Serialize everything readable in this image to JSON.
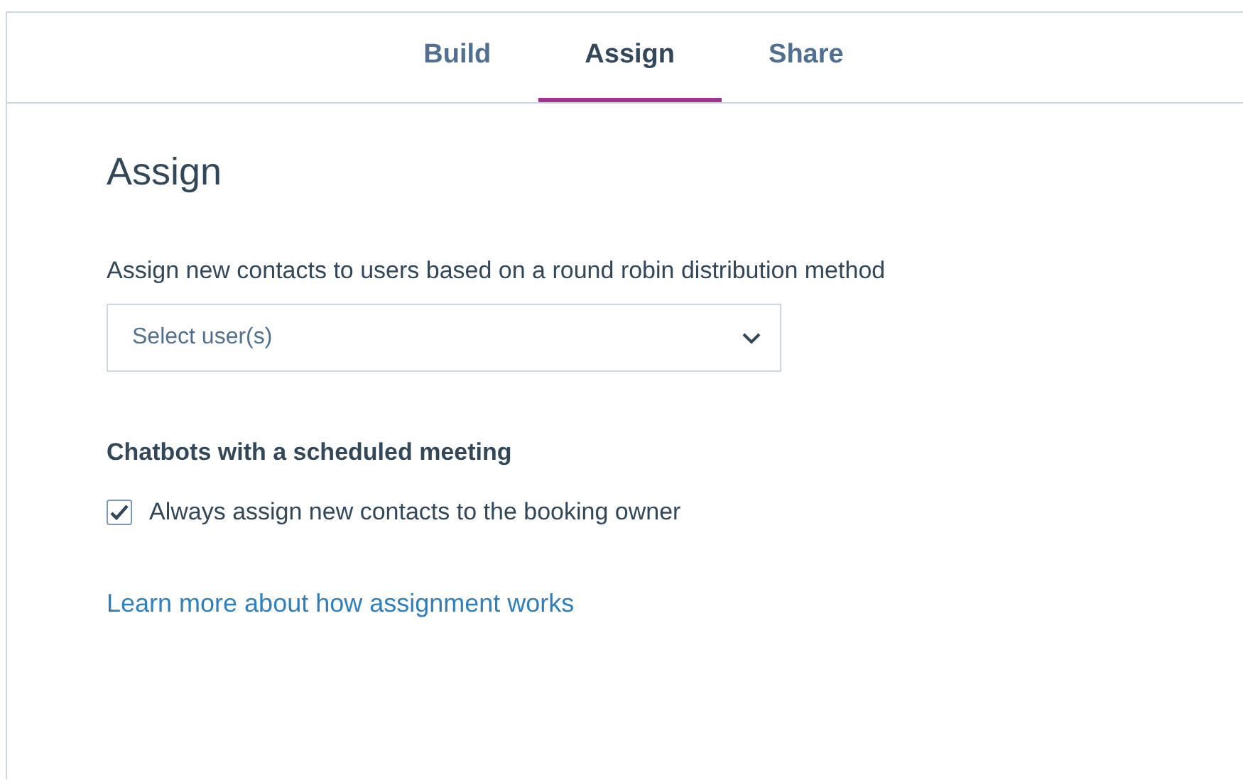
{
  "tabs": [
    {
      "label": "Build",
      "selected": false
    },
    {
      "label": "Assign",
      "selected": true
    },
    {
      "label": "Share",
      "selected": false
    }
  ],
  "heading": "Assign",
  "description": "Assign new contacts to users based on a round robin distribution method",
  "user_select": {
    "placeholder": "Select user(s)"
  },
  "section_title": "Chatbots with a scheduled meeting",
  "checkbox": {
    "label": "Always assign new contacts to the booking owner",
    "checked": true
  },
  "link": "Learn more about how assignment works"
}
